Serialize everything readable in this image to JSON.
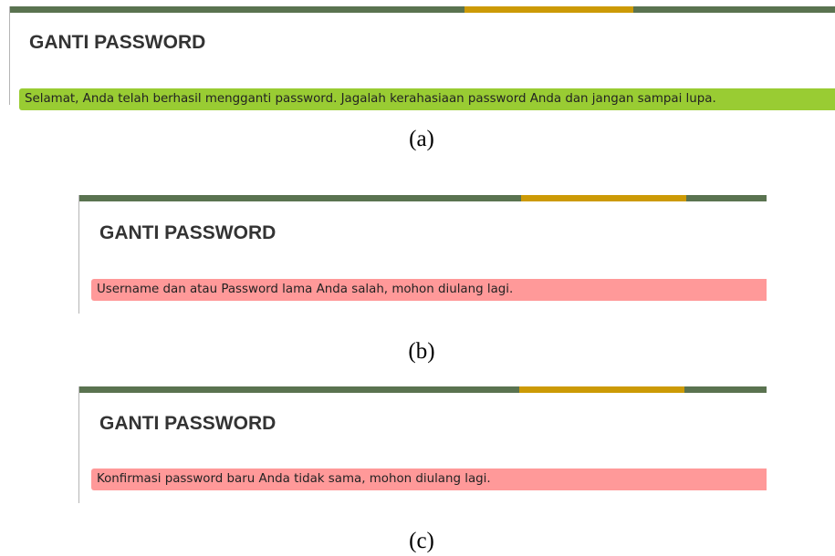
{
  "panels": [
    {
      "title": "GANTI PASSWORD",
      "message": "Selamat, Anda telah berhasil mengganti password. Jagalah kerahasiaan password Anda dan jangan sampai lupa.",
      "status": "success",
      "caption": "(a)"
    },
    {
      "title": "GANTI PASSWORD",
      "message": "Username dan atau Password lama Anda salah, mohon diulang lagi.",
      "status": "error",
      "caption": "(b)"
    },
    {
      "title": "GANTI PASSWORD",
      "message": "Konfirmasi password baru Anda tidak sama, mohon diulang lagi.",
      "status": "error",
      "caption": "(c)"
    }
  ],
  "colors": {
    "topbar": "#5a7350",
    "accent": "#cc9a06",
    "success": "#99cc33",
    "error": "#ff9999"
  }
}
